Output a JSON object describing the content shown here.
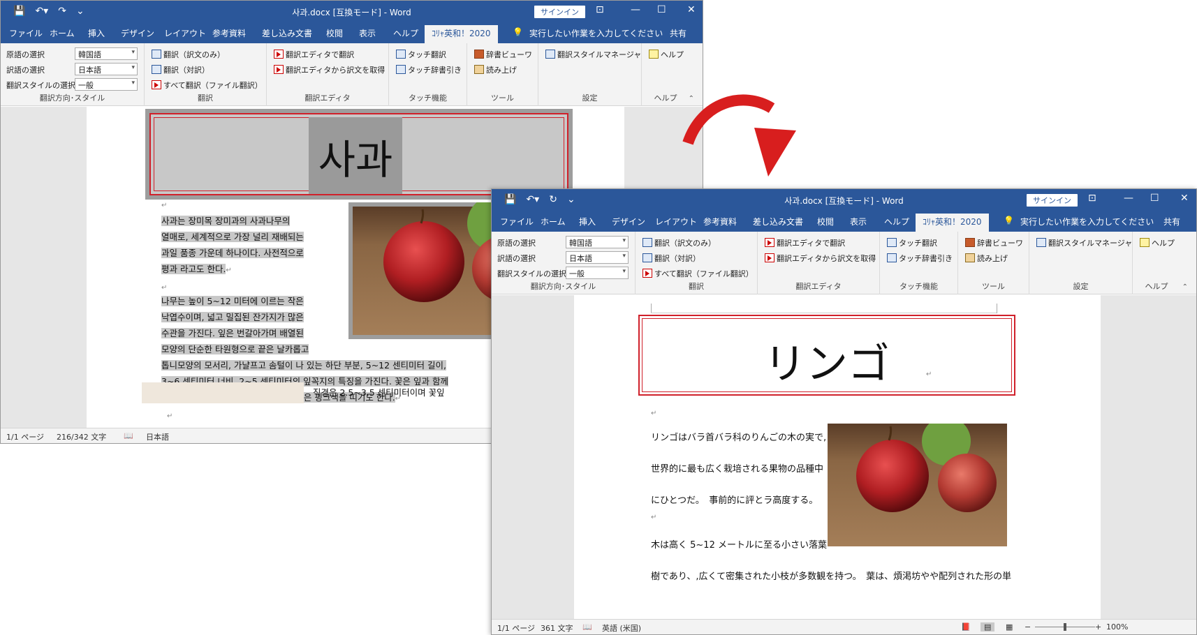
{
  "window1": {
    "title": "사과.docx [互換モード] - Word",
    "signin": "サインイン",
    "tabs": [
      "ファイル",
      "ホーム",
      "挿入",
      "デザイン",
      "レイアウト",
      "参考資料",
      "差し込み文書",
      "校閲",
      "表示",
      "ヘルプ",
      "ｺﾘｬ英和！2020"
    ],
    "tell_me": "実行したい作業を入力してください",
    "share": "共有",
    "doc_title": "사과",
    "paragraph1": [
      "사과는 장미목 장미과의 사과나무의",
      "열매로, 세계적으로 가장 널리 재배되는",
      "과일 품종 가운데 하나이다. 사전적으로",
      "평과 라고도 한다."
    ],
    "paragraph2": [
      "나무는 높이 5~12 미터에 이르는 작은",
      "낙엽수이며, 넓고 밀집된 잔가지가 많은",
      "수관을 가진다. 잎은 번갈아가며 배열된",
      "모양의 단순한 타원형으로 끝은 날카롭고",
      "톱니모양의 모서리, 가냘프고 솜털이 나 있는 하단 부분, 5~12 센티미터 길이,",
      "3~6 센티미터 너비, 2~5 센티미터의 잎꼭지의 특징을 가진다. 꽃은 잎과 함께",
      "나는데 꽃 색깔은 흰색이며 처음에는 옅은 핑크색을 띠기도 한다."
    ],
    "cut_line": "직경은 2.5~3.5 센티미터이며 꽃잎",
    "status": {
      "page": "1/1 ページ",
      "words": "216/342 文字",
      "lang": "日本語"
    }
  },
  "window2": {
    "title": "사과.docx [互換モード] - Word",
    "signin": "サインイン",
    "tabs": [
      "ファイル",
      "ホーム",
      "挿入",
      "デザイン",
      "レイアウト",
      "参考資料",
      "差し込み文書",
      "校閲",
      "表示",
      "ヘルプ",
      "ｺﾘｬ英和！2020"
    ],
    "tell_me": "実行したい作業を入力してください",
    "share": "共有",
    "doc_title": "リンゴ",
    "lines": [
      "リンゴはバラ首バラ科のりんごの木の実で,",
      "世界的に最も広く栽培される果物の品種中",
      "にひとつだ。　事前的に評とラ高度する。",
      "木は高く 5~12 メートルに至る小さい落葉",
      "樹であり、,広くて密集された小枝が多数観を持つ。　葉は、煩渇坊やや配列された形の単"
    ],
    "status": {
      "page": "1/1 ページ",
      "words": "361 文字",
      "lang": "英語 (米国)",
      "zoom": "100%"
    }
  },
  "ribbon": {
    "src_lang_label": "原語の選択",
    "src_lang_value": "韓国語",
    "tgt_lang_label": "訳語の選択",
    "tgt_lang_value": "日本語",
    "style_label": "翻訳スタイルの選択",
    "style_value": "一般",
    "group_direction": "翻訳方向･スタイル",
    "translate_only": "翻訳（訳文のみ）",
    "translate_pair": "翻訳（対訳）",
    "translate_all": "すべて翻訳（ファイル翻訳）",
    "group_translate": "翻訳",
    "editor_translate": "翻訳エディタで翻訳",
    "editor_get": "翻訳エディタから訳文を取得",
    "group_editor": "翻訳エディタ",
    "touch_translate": "タッチ翻訳",
    "touch_dict": "タッチ辞書引き",
    "group_touch": "タッチ機能",
    "dict_viewer": "辞書ビューワ",
    "read_aloud": "読み上げ",
    "group_tools": "ツール",
    "style_manager": "翻訳スタイルマネージャ",
    "group_settings": "設定",
    "help": "ヘルプ",
    "group_help": "ヘルプ"
  },
  "colors": {
    "title_blue": "#2b579a",
    "frame_red": "#d0202a",
    "arrow_red": "#d81e1e",
    "selection_gray": "#c8c8c8"
  }
}
